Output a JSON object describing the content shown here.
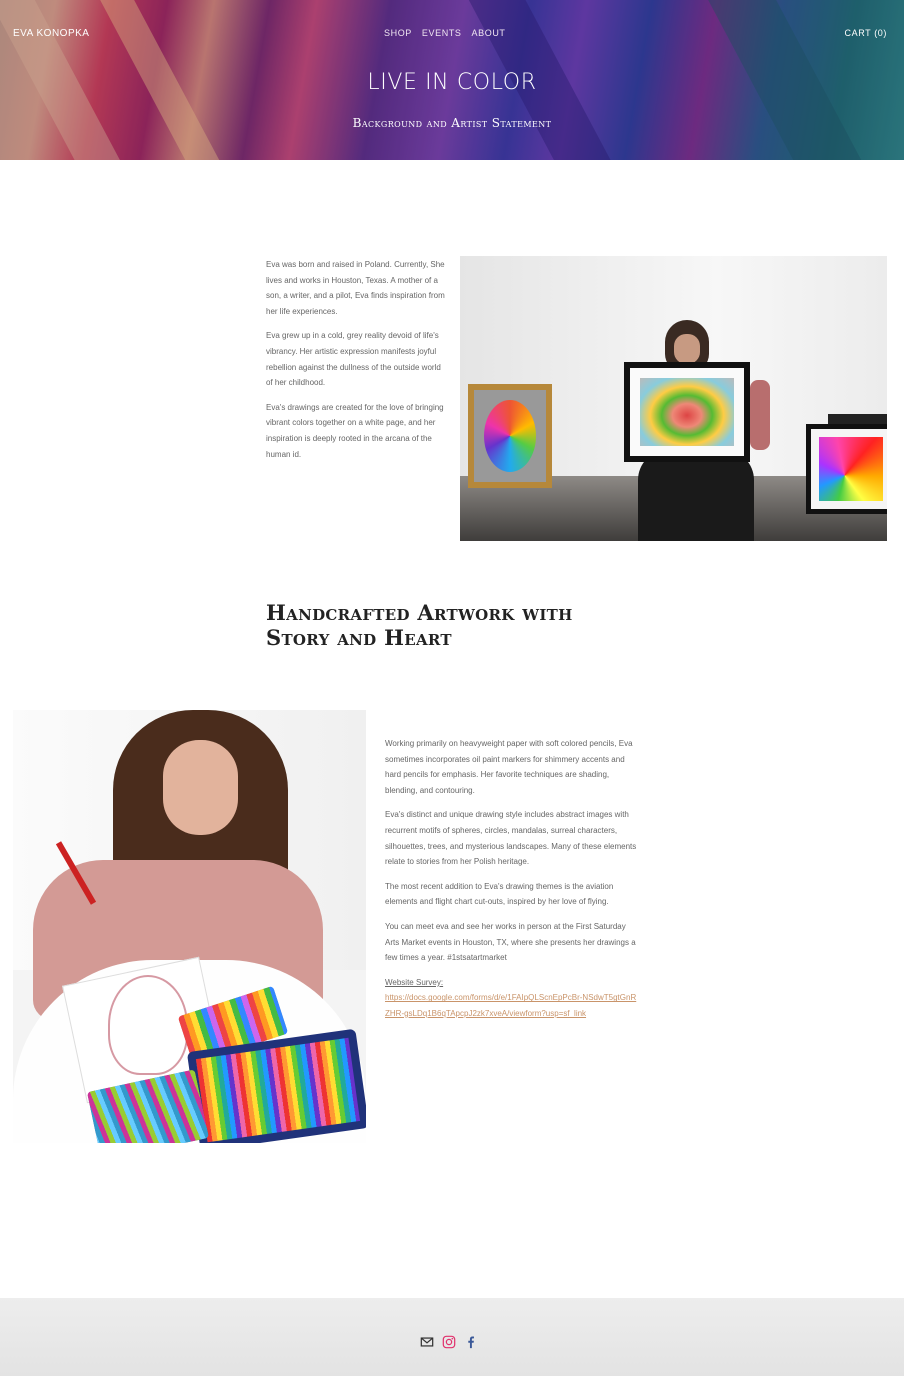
{
  "header": {
    "brand": "EVA KONOPKA",
    "nav": [
      "SHOP",
      "EVENTS",
      "ABOUT"
    ],
    "cart": "CART (0)",
    "title": "LIVE IN COLOR",
    "subtitle": "Background and Artist Statement"
  },
  "intro": {
    "paragraphs": [
      "Eva was born and raised in Poland. Currently, She lives and works in Houston, Texas. A mother of a son, a writer, and a pilot, Eva finds inspiration from her life experiences.",
      "Eva grew up in a cold, grey reality devoid of life's vibrancy. Her artistic expression manifests joyful rebellion against the dullness of the outside world of her childhood.",
      "Eva's drawings are created for the love of bringing vibrant colors together on a white page, and her inspiration is deeply rooted in the arcana of the human id."
    ]
  },
  "section_heading": "Handcrafted Artwork with Story and Heart",
  "details": {
    "paragraphs": [
      "Working primarily on heavyweight paper with soft colored pencils, Eva sometimes incorporates oil paint markers for shimmery accents and hard pencils for emphasis. Her favorite techniques are shading, blending, and contouring.",
      "Eva's distinct and unique drawing style includes abstract images with recurrent motifs of spheres, circles, mandalas, surreal characters, silhouettes, trees, and mysterious landscapes. Many of these elements relate to stories from her Polish heritage.",
      "The most recent addition to Eva's drawing themes is the aviation elements and flight chart cut-outs, inspired by her love of flying.",
      "You can meet eva and see her works in person at the First Saturday Arts Market events in Houston, TX, where she presents her drawings a few times a year. #1stsatartmarket"
    ],
    "survey_label": "Website Survey:",
    "survey_url": "https://docs.google.com/forms/d/e/1FAIpQLScnEpPcBr-NSdwT5gtGnRZHR-gsLDq1B6qTApcpJ2zk7xveA/viewform?usp=sf_link"
  },
  "footer": {
    "icons": [
      "mail-icon",
      "instagram-icon",
      "facebook-icon"
    ],
    "colors": {
      "mail": "#333333",
      "instagram": "#e1306c",
      "facebook": "#3b5998"
    }
  },
  "colors": {
    "accent_link": "#c9946a",
    "heading": "#222222",
    "body_text": "#666666"
  }
}
